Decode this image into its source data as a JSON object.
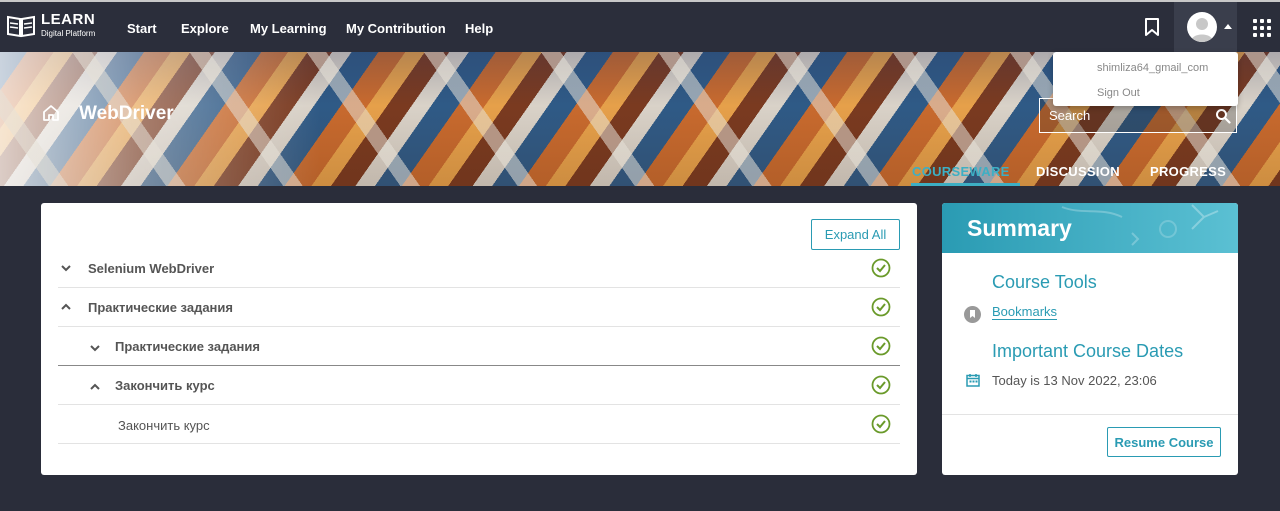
{
  "nav": {
    "logo_title": "LEARN",
    "logo_subtitle": "Digital Platform",
    "links": [
      "Start",
      "Explore",
      "My Learning",
      "My Contribution",
      "Help"
    ]
  },
  "user_menu": {
    "email": "shimliza64_gmail_com",
    "sign_out": "Sign Out"
  },
  "course": {
    "title": "WebDriver"
  },
  "search": {
    "placeholder": "Search"
  },
  "tabs": [
    {
      "label": "COURSEWARE",
      "active": true
    },
    {
      "label": "DISCUSSION",
      "active": false
    },
    {
      "label": "PROGRESS",
      "active": false
    }
  ],
  "courseware": {
    "expand_all": "Expand All",
    "rows": [
      {
        "label": "Selenium WebDriver",
        "level": 0,
        "expanded": false,
        "completed": true
      },
      {
        "label": "Практические задания",
        "level": 0,
        "expanded": true,
        "completed": true
      },
      {
        "label": "Практические задания",
        "level": 1,
        "expanded": false,
        "completed": true
      },
      {
        "label": "Закончить курс",
        "level": 1,
        "expanded": true,
        "completed": true
      },
      {
        "label": "Закончить курс",
        "level": 2,
        "completed": true
      }
    ]
  },
  "summary": {
    "title": "Summary",
    "course_tools": "Course Tools",
    "bookmarks": "Bookmarks",
    "important_dates": "Important Course Dates",
    "today": "Today is 13 Nov 2022, 23:06",
    "resume": "Resume Course"
  },
  "colors": {
    "accent": "#2a9bb3",
    "navbar": "#2b2e3b",
    "check": "#6a9a2a"
  }
}
